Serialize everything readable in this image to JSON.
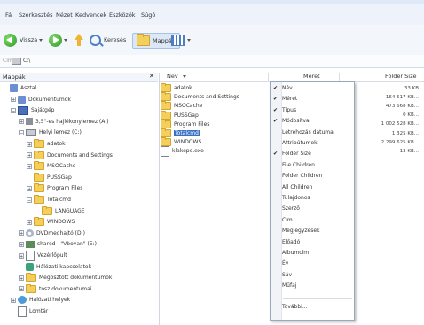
{
  "menubar": {
    "items": [
      "Fá",
      "Szerkesztés",
      "Nézet",
      "Kedvencek",
      "Eszközök",
      "Súgó"
    ]
  },
  "toolbar": {
    "back_label": "Vissza",
    "search_label": "Keresés",
    "folders_label": "Mappák"
  },
  "address": {
    "label": "Cím",
    "value": "C:\\"
  },
  "folders_pane": {
    "title": "Mappák",
    "close": "✕",
    "tree": [
      {
        "label": "Asztal",
        "indent": 0,
        "icon": "desktop-icon",
        "expander": ""
      },
      {
        "label": "Dokumentumok",
        "indent": 1,
        "icon": "documents-icon",
        "expander": "+"
      },
      {
        "label": "Sajátgép",
        "indent": 1,
        "icon": "computer-icon",
        "expander": "−"
      },
      {
        "label": "3,5\"-es hajlékonylemez (A:)",
        "indent": 2,
        "icon": "floppy-icon",
        "expander": "+"
      },
      {
        "label": "Helyi lemez (C:)",
        "indent": 2,
        "icon": "drive-icon",
        "expander": "−"
      },
      {
        "label": "adatok",
        "indent": 3,
        "icon": "folder-icon",
        "expander": "+"
      },
      {
        "label": "Documents and Settings",
        "indent": 3,
        "icon": "folder-icon",
        "expander": "+"
      },
      {
        "label": "MSOCache",
        "indent": 3,
        "icon": "folder-icon",
        "expander": "+"
      },
      {
        "label": "PUSSGap",
        "indent": 3,
        "icon": "folder-icon",
        "expander": ""
      },
      {
        "label": "Program Files",
        "indent": 3,
        "icon": "folder-icon",
        "expander": "+"
      },
      {
        "label": "Totalcmd",
        "indent": 3,
        "icon": "folder-icon",
        "expander": "−"
      },
      {
        "label": "LANGUAGE",
        "indent": 4,
        "icon": "folder-icon",
        "expander": ""
      },
      {
        "label": "WINDOWS",
        "indent": 3,
        "icon": "folder-icon",
        "expander": "+"
      },
      {
        "label": "DVDmeghajtó (D:)",
        "indent": 2,
        "icon": "dvd-icon",
        "expander": "+"
      },
      {
        "label": "shared - \"Vbovan\" (E:)",
        "indent": 2,
        "icon": "network-drive-icon",
        "expander": "+"
      },
      {
        "label": "Vezérlőpult",
        "indent": 2,
        "icon": "control-panel-icon",
        "expander": "+"
      },
      {
        "label": "Hálózati kapcsolatok",
        "indent": 2,
        "icon": "network-connections-icon",
        "expander": ""
      },
      {
        "label": "Megosztott dokumentumok",
        "indent": 2,
        "icon": "folder-icon",
        "expander": "+"
      },
      {
        "label": "tosz dokumentumai",
        "indent": 2,
        "icon": "folder-icon",
        "expander": "+"
      },
      {
        "label": "Hálózati helyek",
        "indent": 1,
        "icon": "network-places-icon",
        "expander": "+"
      },
      {
        "label": "Lomtár",
        "indent": 1,
        "icon": "recycle-bin-icon",
        "expander": ""
      }
    ]
  },
  "columns": {
    "name": "Név",
    "size": "Méret",
    "folder_size": "Folder Size"
  },
  "files": [
    {
      "name": "adatok",
      "icon": "folder-icon",
      "folder_size": "33 KB"
    },
    {
      "name": "Documents and Settings",
      "icon": "folder-icon",
      "folder_size": "164 517 KB..."
    },
    {
      "name": "MSOCache",
      "icon": "folder-icon",
      "folder_size": "473 668 KB..."
    },
    {
      "name": "PUSSGap",
      "icon": "folder-icon",
      "folder_size": "0 KB..."
    },
    {
      "name": "Program Files",
      "icon": "folder-icon",
      "folder_size": "1 002 528 KB..."
    },
    {
      "name": "Totalcmd",
      "icon": "folder-icon",
      "folder_size": "1 325 KB..."
    },
    {
      "name": "WINDOWS",
      "icon": "folder-icon",
      "folder_size": "2 299 625 KB..."
    },
    {
      "name": "klakepe.exe",
      "icon": "exe-icon",
      "folder_size": "13 KB..."
    }
  ],
  "context_menu": {
    "items": [
      {
        "label": "Név",
        "checked": true
      },
      {
        "label": "Méret",
        "checked": true
      },
      {
        "label": "Típus",
        "checked": true
      },
      {
        "label": "Módosítva",
        "checked": true
      },
      {
        "label": "Létrehozás dátuma",
        "checked": false
      },
      {
        "label": "Attribútumok",
        "checked": false
      },
      {
        "label": "Folder Size",
        "checked": true
      },
      {
        "label": "File Children",
        "checked": false
      },
      {
        "label": "Folder Children",
        "checked": false
      },
      {
        "label": "All Children",
        "checked": false
      },
      {
        "label": "Tulajdonos",
        "checked": false
      },
      {
        "label": "Szerző",
        "checked": false
      },
      {
        "label": "Cím",
        "checked": false
      },
      {
        "label": "Megjegyzések",
        "checked": false
      },
      {
        "label": "Előadó",
        "checked": false
      },
      {
        "label": "Albumcím",
        "checked": false
      },
      {
        "label": "Év",
        "checked": false
      },
      {
        "label": "Sáv",
        "checked": false
      },
      {
        "label": "Műfaj",
        "checked": false
      }
    ],
    "more_label": "További..."
  }
}
